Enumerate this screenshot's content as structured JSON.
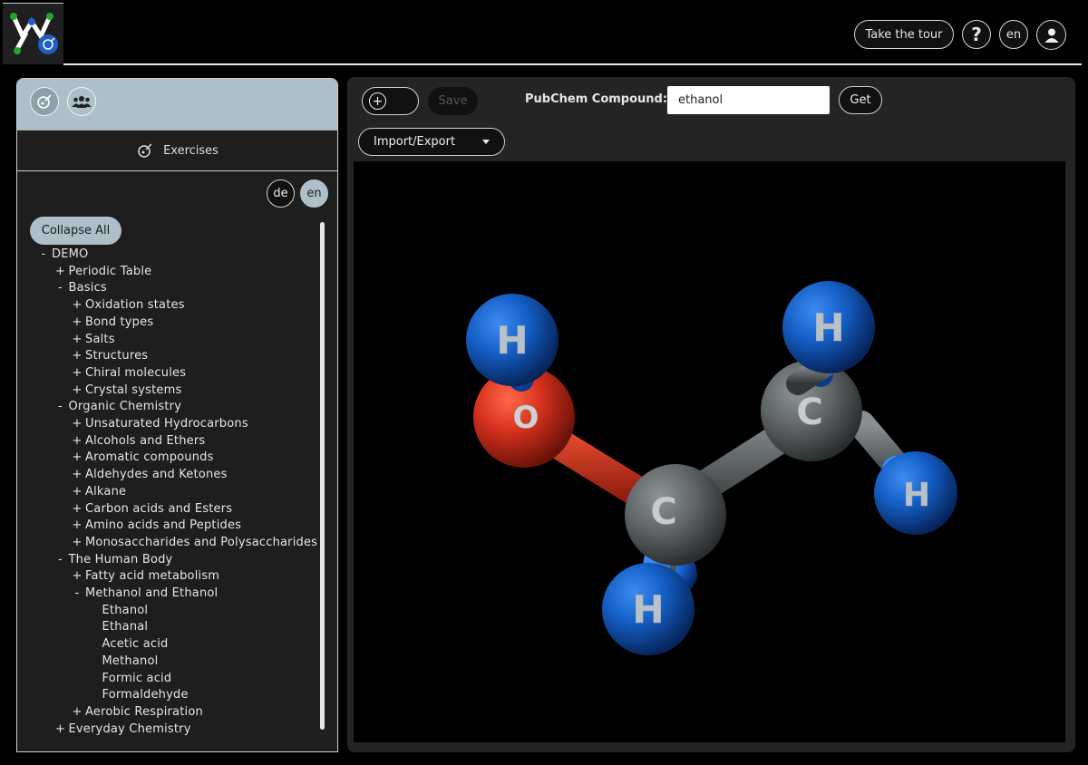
{
  "header": {
    "tour_label": "Take the tour",
    "help_label": "?",
    "lang_label": "en"
  },
  "left": {
    "exercises_label": "Exercises",
    "lang_de": "de",
    "lang_en": "en",
    "collapse_label": "Collapse All",
    "tree": [
      {
        "level": 0,
        "toggle": "-",
        "label": "DEMO"
      },
      {
        "level": 1,
        "toggle": "+",
        "label": "Periodic Table"
      },
      {
        "level": 1,
        "toggle": "-",
        "label": "Basics"
      },
      {
        "level": 2,
        "toggle": "+",
        "label": "Oxidation states"
      },
      {
        "level": 2,
        "toggle": "+",
        "label": "Bond types"
      },
      {
        "level": 2,
        "toggle": "+",
        "label": "Salts"
      },
      {
        "level": 2,
        "toggle": "+",
        "label": "Structures"
      },
      {
        "level": 2,
        "toggle": "+",
        "label": "Chiral molecules"
      },
      {
        "level": 2,
        "toggle": "+",
        "label": "Crystal systems"
      },
      {
        "level": 1,
        "toggle": "-",
        "label": "Organic Chemistry"
      },
      {
        "level": 2,
        "toggle": "+",
        "label": "Unsaturated Hydrocarbons"
      },
      {
        "level": 2,
        "toggle": "+",
        "label": "Alcohols and Ethers"
      },
      {
        "level": 2,
        "toggle": "+",
        "label": "Aromatic compounds"
      },
      {
        "level": 2,
        "toggle": "+",
        "label": "Aldehydes and Ketones"
      },
      {
        "level": 2,
        "toggle": "+",
        "label": "Alkane"
      },
      {
        "level": 2,
        "toggle": "+",
        "label": "Carbon acids and Esters"
      },
      {
        "level": 2,
        "toggle": "+",
        "label": "Amino acids and Peptides"
      },
      {
        "level": 2,
        "toggle": "+",
        "label": "Monosaccharides and Polysaccharides"
      },
      {
        "level": 1,
        "toggle": "-",
        "label": "The Human Body"
      },
      {
        "level": 2,
        "toggle": "+",
        "label": "Fatty acid metabolism"
      },
      {
        "level": 2,
        "toggle": "-",
        "label": "Methanol and Ethanol"
      },
      {
        "level": 3,
        "toggle": "",
        "label": "Ethanol"
      },
      {
        "level": 3,
        "toggle": "",
        "label": "Ethanal"
      },
      {
        "level": 3,
        "toggle": "",
        "label": "Acetic acid"
      },
      {
        "level": 3,
        "toggle": "",
        "label": "Methanol"
      },
      {
        "level": 3,
        "toggle": "",
        "label": "Formic acid"
      },
      {
        "level": 3,
        "toggle": "",
        "label": "Formaldehyde"
      },
      {
        "level": 2,
        "toggle": "+",
        "label": "Aerobic Respiration"
      },
      {
        "level": 1,
        "toggle": "+",
        "label": "Everyday Chemistry"
      }
    ]
  },
  "toolbar": {
    "save_label": "Save",
    "pubchem_label": "PubChem Compound:",
    "pubchem_value": "ethanol",
    "get_label": "Get",
    "import_label": "Import/Export"
  },
  "molecule": {
    "name": "ethanol",
    "atom_labels": {
      "H": "H",
      "O": "O",
      "C": "C"
    },
    "colors": {
      "hydrogen": "#1560c8",
      "oxygen": "#d8321f",
      "carbon": "#5f6466",
      "bond": "#666b6d",
      "accent": "#aebfc9"
    }
  }
}
